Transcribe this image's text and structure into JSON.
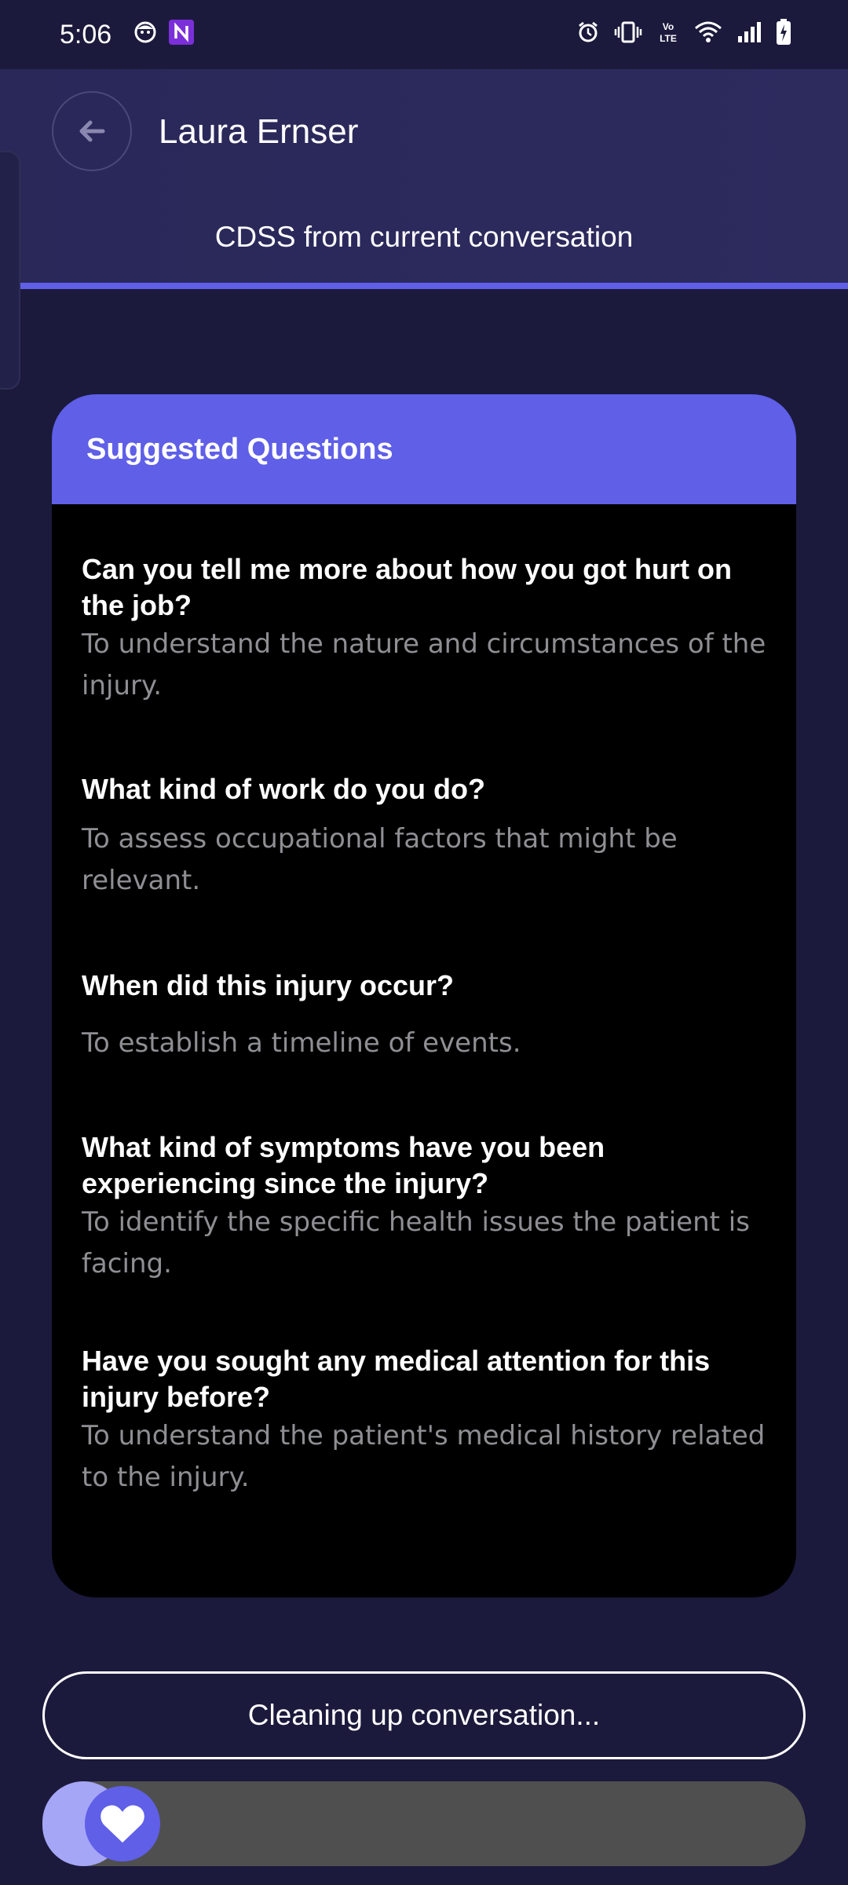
{
  "status_bar": {
    "time": "5:06",
    "icons_left": [
      "face-notification-icon",
      "n-app-icon"
    ],
    "icons_right": [
      "alarm-icon",
      "vibrate-icon",
      "volte-icon",
      "wifi-icon",
      "signal-icon",
      "battery-charging-icon"
    ],
    "volte_label": "Vo LTE"
  },
  "header": {
    "back_icon": "arrow-left-icon",
    "title": "Laura Ernser",
    "subtitle": "CDSS from current conversation"
  },
  "card": {
    "title": "Suggested Questions",
    "questions": [
      {
        "question": "Can you tell me more about how you got hurt on the job?",
        "reason": "To understand the nature and circumstances of the injury."
      },
      {
        "question": "What kind of work do you do?",
        "reason": "To assess occupational factors that might be relevant."
      },
      {
        "question": "When did this injury occur?",
        "reason": "To establish a timeline of events."
      },
      {
        "question": "What kind of symptoms have you been experiencing since the injury?",
        "reason": "To identify the specific health issues the patient is facing."
      },
      {
        "question": "Have you sought any medical attention for this injury before?",
        "reason": "To understand the patient's medical history related to the injury."
      }
    ]
  },
  "bottom": {
    "cleanup_label": "Cleaning up conversation...",
    "slider_icon": "heart-icon"
  },
  "colors": {
    "background": "#1b1a3c",
    "header": "#2a2859",
    "accent": "#5f5fe8",
    "card": "#000000",
    "muted_text": "#8e8e93",
    "slider_track": "#4f4f4f",
    "slider_fill": "#a6a6f7"
  }
}
